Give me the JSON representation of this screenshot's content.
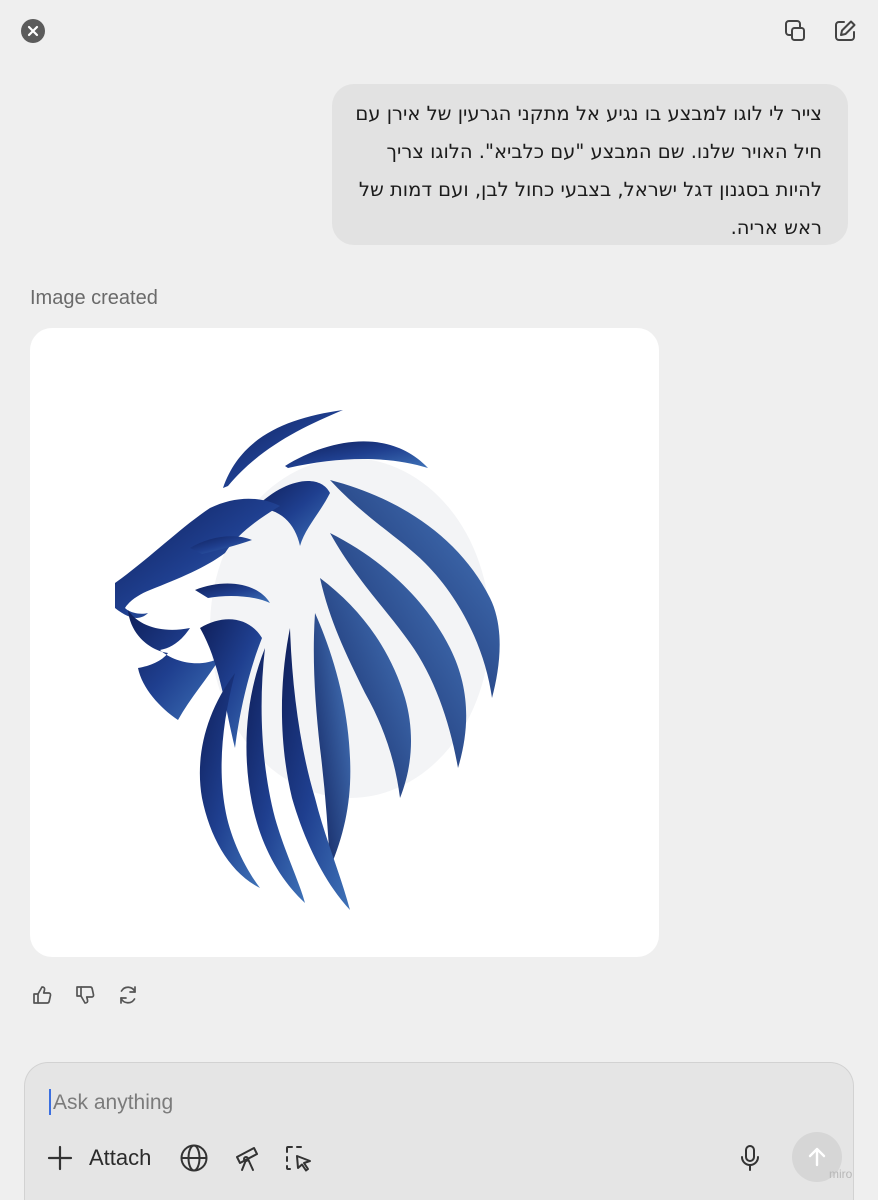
{
  "header": {
    "close_icon": "close-icon",
    "copy_icon": "copy-window-icon",
    "new_chat_icon": "edit-icon"
  },
  "conversation": {
    "user_message": "צייר לי לוגו למבצע בו נגיע אל מתקני הגרעין של אירן עם חיל האויר שלנו. שם המבצע \"עם כלביא\". הלוגו צריך להיות בסגנון דגל ישראל, בצבעי כחול לבן, ועם דמות של ראש אריה.",
    "status_label": "Image created",
    "image": {
      "subject": "blue-lion-head-logo",
      "colors": [
        "#1f3f8f",
        "#3f73b8",
        "#0f1f5a"
      ]
    },
    "actions": [
      "thumbs-up-icon",
      "thumbs-down-icon",
      "regenerate-icon"
    ]
  },
  "composer": {
    "placeholder": "Ask anything",
    "attach_label": "Attach",
    "tools": [
      "plus-icon",
      "globe-icon",
      "telescope-icon",
      "cursor-select-icon"
    ],
    "mic_icon": "microphone-icon",
    "send_icon": "arrow-up-icon",
    "watermark": "miro"
  },
  "colors": {
    "background": "#efefef",
    "bubble": "#e2e2e2",
    "accent_blue": "#1f3f8f"
  }
}
